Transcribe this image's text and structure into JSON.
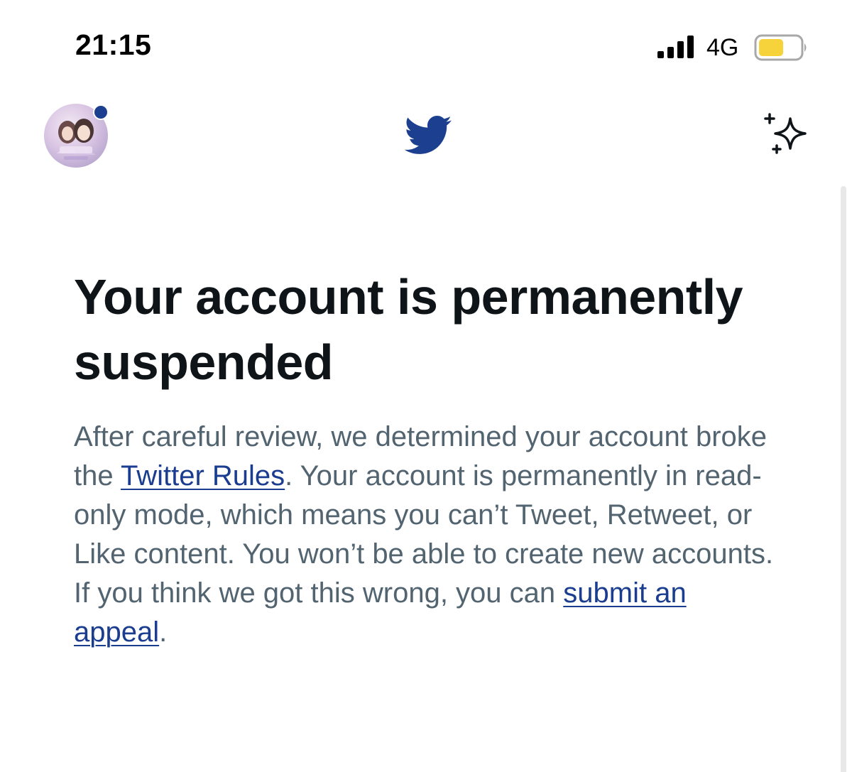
{
  "status_bar": {
    "time": "21:15",
    "network": "4G",
    "battery_color": "#f7d33b"
  },
  "header": {
    "avatar_icon": "profile-avatar",
    "logo_icon": "twitter-bird-icon",
    "action_icon": "sparkle-icon",
    "brand_color": "#1d3f8f"
  },
  "main": {
    "title": "Your account is permanently suspended",
    "body": {
      "text_1": "After careful review, we determined your account broke the ",
      "link_rules": "Twitter Rules",
      "text_2": ". Your account is permanently in read-only mode, which means you can’t Tweet, Retweet, or Like content. You won’t be able to create new accounts. If you think we got this wrong, you can ",
      "link_appeal": "submit an appeal",
      "text_3": "."
    }
  }
}
